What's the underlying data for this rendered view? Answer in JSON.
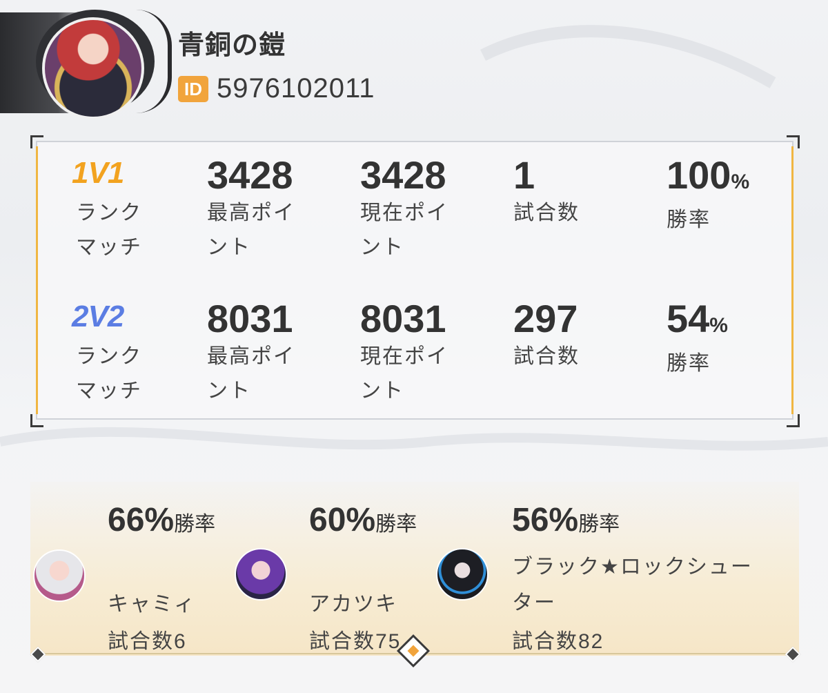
{
  "profile": {
    "name": "青銅の鎧",
    "id_badge": "ID",
    "id_value": "5976102011"
  },
  "ranked": [
    {
      "mode_logo": "1V1",
      "mode_name": "ランクマッチ",
      "best_points": "3428",
      "best_points_label": "最高ポイント",
      "current_points": "3428",
      "current_points_label": "現在ポイント",
      "matches": "1",
      "matches_label": "試合数",
      "win_rate": "100",
      "win_rate_unit": "%",
      "win_rate_label": "勝率"
    },
    {
      "mode_logo": "2V2",
      "mode_name": "ランクマッチ",
      "best_points": "8031",
      "best_points_label": "最高ポイント",
      "current_points": "8031",
      "current_points_label": "現在ポイント",
      "matches": "297",
      "matches_label": "試合数",
      "win_rate": "54",
      "win_rate_unit": "%",
      "win_rate_label": "勝率"
    }
  ],
  "characters": [
    {
      "rate": "66%",
      "rate_suffix": "勝率",
      "name": "キャミィ",
      "matches": "試合数6"
    },
    {
      "rate": "60%",
      "rate_suffix": "勝率",
      "name": "アカツキ",
      "matches": "試合数75"
    },
    {
      "rate": "56%",
      "rate_suffix": "勝率",
      "name": "ブラック★ロックシューター",
      "matches": "試合数82"
    }
  ],
  "colors": {
    "accent_gold": "#f1a43c",
    "logo_1v1": "#f2a21f",
    "logo_2v2": "#5b7de3"
  }
}
